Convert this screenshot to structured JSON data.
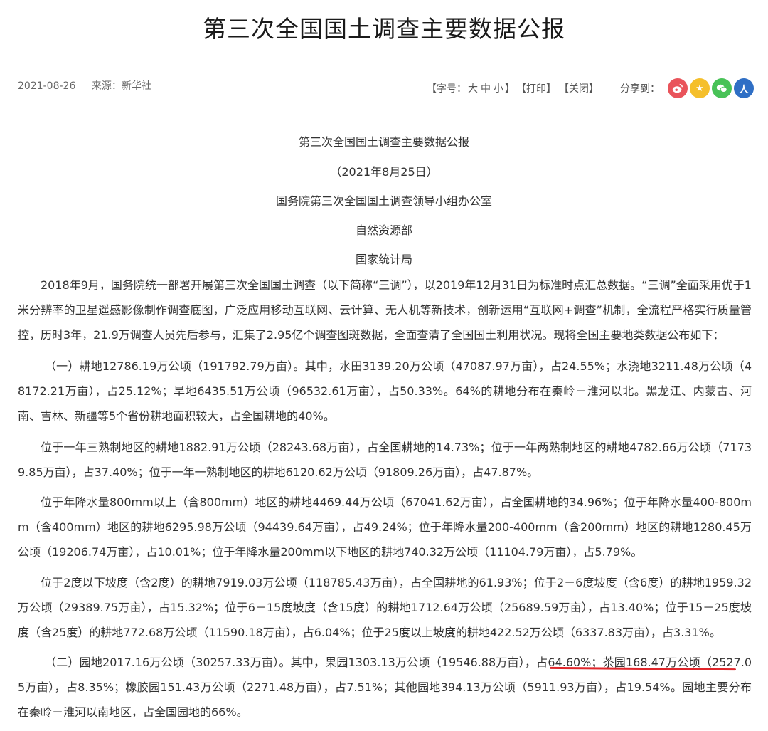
{
  "header": {
    "title": "第三次全国国土调查主要数据公报",
    "date": "2021-08-26",
    "source": "来源：新华社"
  },
  "toolbar": {
    "font_size_label": "【字号：",
    "font_large": "大",
    "font_medium": "中",
    "font_small": "小",
    "font_close": "】",
    "print": "【打印】",
    "close": "【关闭】",
    "share_label": "分享到："
  },
  "share_buttons": [
    {
      "name": "weibo",
      "color": "#e9545b",
      "glyph": ""
    },
    {
      "name": "qzone",
      "color": "#f5bf2b",
      "glyph": "★"
    },
    {
      "name": "wechat",
      "color": "#48c257",
      "glyph": ""
    },
    {
      "name": "people",
      "color": "#2f6fc5",
      "glyph": "人"
    }
  ],
  "article": {
    "heading": "第三次全国国土调查主要数据公报",
    "date_line": "（2021年8月25日）",
    "issuer_1": "国务院第三次全国国土调查领导小组办公室",
    "issuer_2": "自然资源部",
    "issuer_3": "国家统计局",
    "p1": "2018年9月，国务院统一部署开展第三次全国国土调查（以下简称“三调”），以2019年12月31日为标准时点汇总数据。“三调”全面采用优于1米分辨率的卫星遥感影像制作调查底图，广泛应用移动互联网、云计算、无人机等新技术，创新运用“互联网+调查”机制，全流程严格实行质量管控，历时3年，21.9万调查人员先后参与，汇集了2.95亿个调查图斑数据，全面查清了全国国土利用状况。现将全国主要地类数据公布如下：",
    "p2": "（一）耕地12786.19万公顷（191792.79万亩）。其中，水田3139.20万公顷（47087.97万亩），占24.55%；水浇地3211.48万公顷（48172.21万亩），占25.12%；旱地6435.51万公顷（96532.61万亩），占50.33%。64%的耕地分布在秦岭－淮河以北。黑龙江、内蒙古、河南、吉林、新疆等5个省份耕地面积较大，占全国耕地的40%。",
    "p3": "位于一年三熟制地区的耕地1882.91万公顷（28243.68万亩），占全国耕地的14.73%；位于一年两熟制地区的耕地4782.66万公顷（71739.85万亩），占37.40%；位于一年一熟制地区的耕地6120.62万公顷（91809.26万亩），占47.87%。",
    "p4": "位于年降水量800mm以上（含800mm）地区的耕地4469.44万公顷（67041.62万亩），占全国耕地的34.96%；位于年降水量400-800mm（含400mm）地区的耕地6295.98万公顷（94439.64万亩），占49.24%；位于年降水量200-400mm（含200mm）地区的耕地1280.45万公顷（19206.74万亩），占10.01%；位于年降水量200mm以下地区的耕地740.32万公顷（11104.79万亩），占5.79%。",
    "p5": "位于2度以下坡度（含2度）的耕地7919.03万公顷（118785.43万亩），占全国耕地的61.93%；位于2－6度坡度（含6度）的耕地1959.32万公顷（29389.75万亩），占15.32%；位于6－15度坡度（含15度）的耕地1712.64万公顷（25689.59万亩），占13.40%；位于15－25度坡度（含25度）的耕地772.68万公顷（11590.18万亩），占6.04%；位于25度以上坡度的耕地422.52万公顷（6337.83万亩），占3.31%。",
    "p6": "（二）园地2017.16万公顷（30257.33万亩）。其中，果园1303.13万公顷（19546.88万亩），占64.60%；茶园168.47万公顷（2527.05万亩），占8.35%；橡胶园151.43万公顷（2271.48万亩），占7.51%；其他园地394.13万公顷（5911.93万亩），占19.54%。园地主要分布在秦岭－淮河以南地区，占全国园地的66%。"
  },
  "annotation": {
    "underline_color": "#e0262b"
  }
}
